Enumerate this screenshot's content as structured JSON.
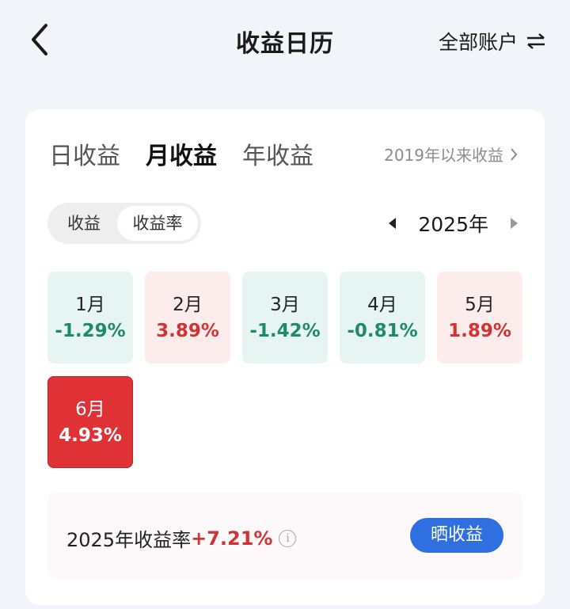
{
  "header": {
    "title": "收益日历",
    "account_label": "全部账户"
  },
  "tabs": [
    {
      "label": "日收益",
      "active": false
    },
    {
      "label": "月收益",
      "active": true
    },
    {
      "label": "年收益",
      "active": false
    }
  ],
  "since_link": "2019年以来收益",
  "toggle": {
    "option1": "收益",
    "option2": "收益率",
    "selected": "收益率"
  },
  "year_nav": {
    "year": "2025年"
  },
  "months": [
    {
      "name": "1月",
      "value": "-1.29%",
      "trend": "down"
    },
    {
      "name": "2月",
      "value": "3.89%",
      "trend": "up"
    },
    {
      "name": "3月",
      "value": "-1.42%",
      "trend": "down"
    },
    {
      "name": "4月",
      "value": "-0.81%",
      "trend": "down"
    },
    {
      "name": "5月",
      "value": "1.89%",
      "trend": "up"
    },
    {
      "name": "6月",
      "value": "4.93%",
      "trend": "hot"
    }
  ],
  "summary": {
    "label": "2025年收益率",
    "rate": "+7.21%",
    "share_label": "晒收益"
  },
  "colors": {
    "gain": "#cf3434",
    "loss": "#1f8a6a",
    "accent": "#2f6fe0",
    "highlight": "#e03236"
  }
}
